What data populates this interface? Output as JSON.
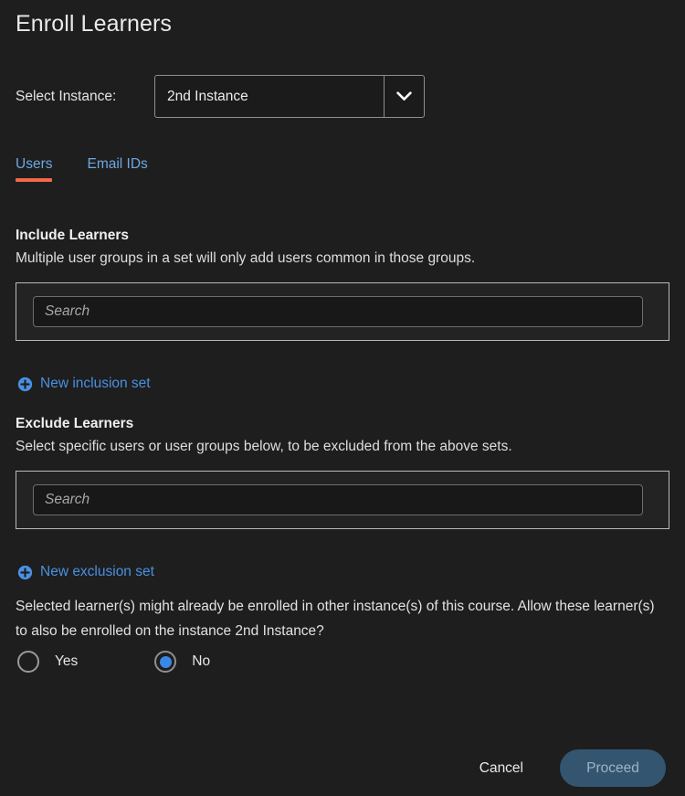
{
  "dialog": {
    "title": "Enroll Learners"
  },
  "instance": {
    "label": "Select Instance:",
    "selected": "2nd Instance",
    "chevron_icon": "chevron-down-icon"
  },
  "tabs": [
    {
      "label": "Users",
      "active": true
    },
    {
      "label": "Email IDs",
      "active": false
    }
  ],
  "include": {
    "heading": "Include Learners",
    "subtext": "Multiple user groups in a set will only add users common in those groups.",
    "search_placeholder": "Search",
    "search_value": "",
    "add_link": "New inclusion set",
    "add_icon": "plus-circle-icon"
  },
  "exclude": {
    "heading": "Exclude Learners",
    "subtext": "Select specific users or user groups below, to be excluded from the above sets.",
    "search_placeholder": "Search",
    "search_value": "",
    "add_link": "New exclusion set",
    "add_icon": "plus-circle-icon"
  },
  "allow_enroll": {
    "question": "Selected learner(s) might already be enrolled in other instance(s) of this course. Allow these learner(s) to also be enrolled on the instance 2nd Instance?",
    "options": [
      {
        "label": "Yes",
        "selected": false
      },
      {
        "label": "No",
        "selected": true
      }
    ]
  },
  "footer": {
    "cancel_label": "Cancel",
    "proceed_label": "Proceed"
  },
  "colors": {
    "background": "#1e1e1e",
    "tab_text": "#6ea8e0",
    "tab_underline": "#f2684a",
    "link_blue": "#4a90e2",
    "radio_selected": "#3b87e8",
    "proceed_bg": "#34556f",
    "proceed_text": "#9fb3c8"
  }
}
